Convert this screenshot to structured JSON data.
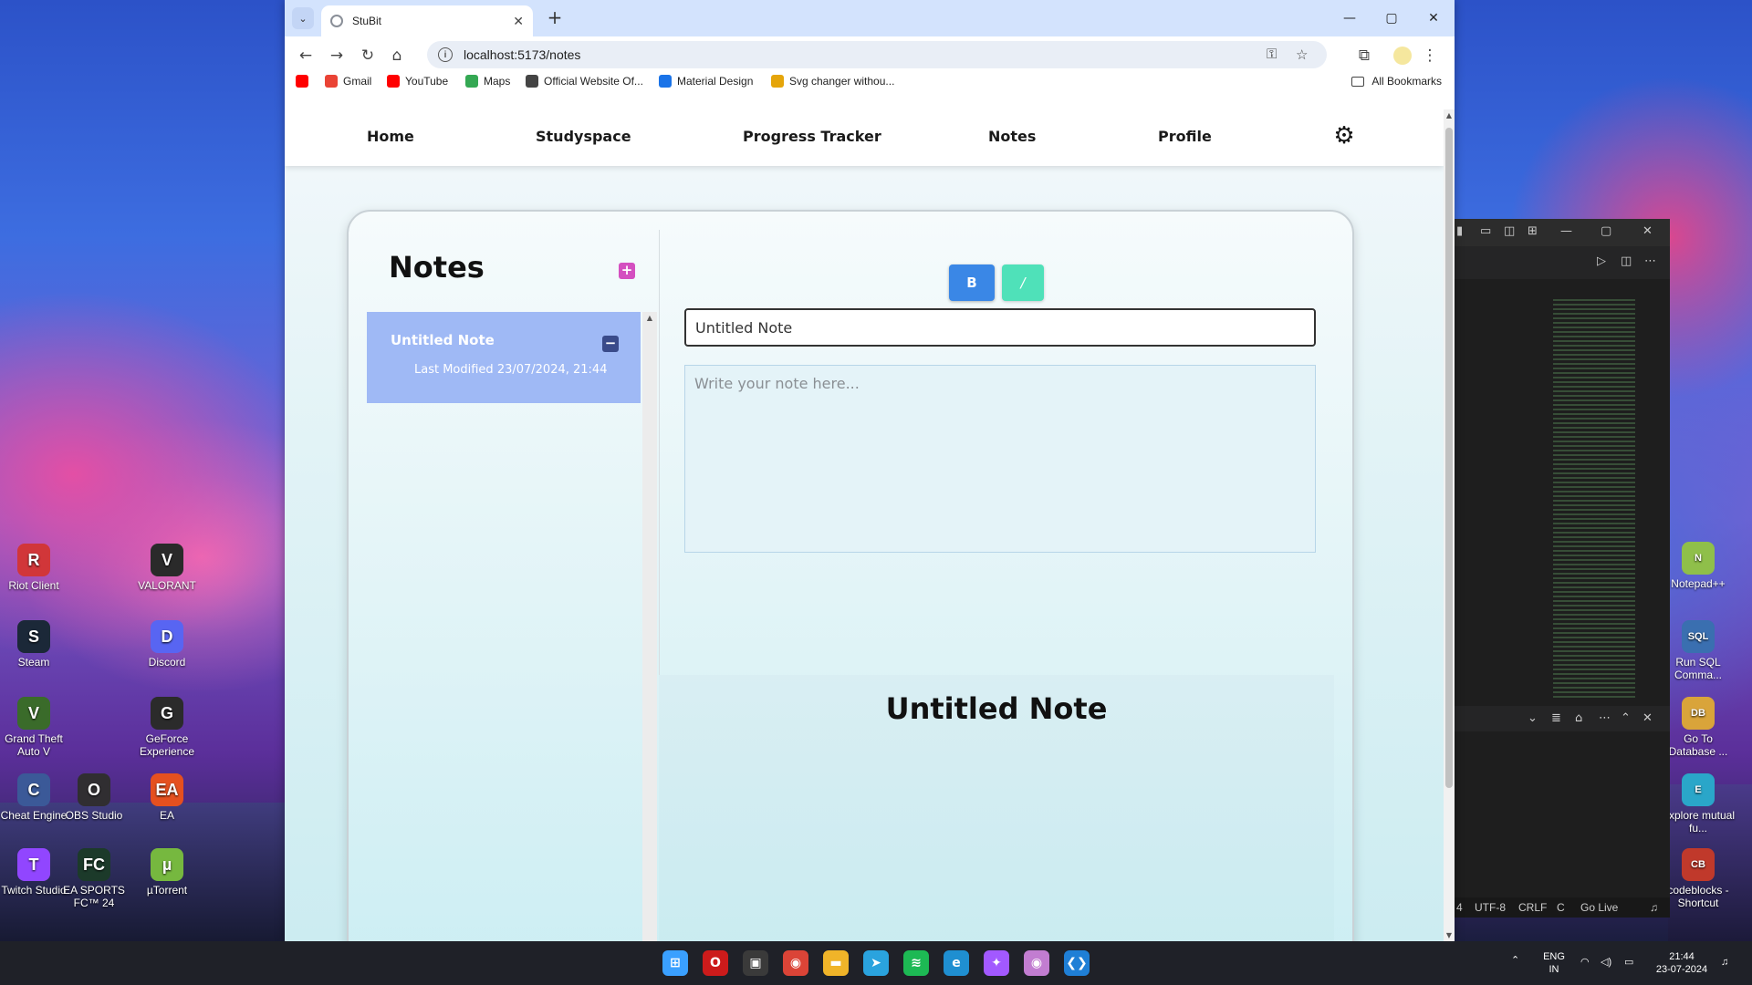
{
  "colors": {
    "tabbar": "#d3e3fd",
    "note_item_bg": "#9fb9f5",
    "bold_button": "#3a87e6",
    "italic_button": "#4fe1b9",
    "add_button": "#d44fc0",
    "remove_button": "#3a4b8a"
  },
  "desktop_left": [
    {
      "label": "Riot Client",
      "icon": "riot-icon",
      "color": "#d13639",
      "glyph": "R"
    },
    {
      "label": "VALORANT",
      "icon": "valorant-icon",
      "color": "#2a2a2a",
      "glyph": "V"
    },
    {
      "label": "Steam",
      "icon": "steam-icon",
      "color": "#1b2838",
      "glyph": "S"
    },
    {
      "label": "Discord",
      "icon": "discord-icon",
      "color": "#5865f2",
      "glyph": "D"
    },
    {
      "label": "Grand Theft Auto V",
      "icon": "gta-icon",
      "color": "#3a6b2a",
      "glyph": "V"
    },
    {
      "label": "GeForce Experience",
      "icon": "geforce-icon",
      "color": "#2b2b2b",
      "glyph": "G"
    },
    {
      "label": "Cheat Engine",
      "icon": "cheat-engine-icon",
      "color": "#3b5998",
      "glyph": "C"
    },
    {
      "label": "OBS Studio",
      "icon": "obs-icon",
      "color": "#302e31",
      "glyph": "O"
    },
    {
      "label": "EA",
      "icon": "ea-icon",
      "color": "#e5501f",
      "glyph": "EA"
    },
    {
      "label": "Twitch Studio",
      "icon": "twitch-icon",
      "color": "#9146ff",
      "glyph": "T"
    },
    {
      "label": "EA SPORTS FC™ 24",
      "icon": "fc24-icon",
      "color": "#1c3a2a",
      "glyph": "FC"
    },
    {
      "label": "µTorrent",
      "icon": "utorrent-icon",
      "color": "#76b83f",
      "glyph": "µ"
    }
  ],
  "desktop_right": [
    {
      "label": "Notepad++",
      "icon": "notepadpp-icon",
      "color": "#8fbf4a",
      "glyph": "N"
    },
    {
      "label": "Run SQL Comma...",
      "icon": "sql-icon",
      "color": "#3a6fb0",
      "glyph": "SQL"
    },
    {
      "label": "Go To Database ...",
      "icon": "database-icon",
      "color": "#d9a43a",
      "glyph": "DB"
    },
    {
      "label": "Explore mutual fu...",
      "icon": "explore-icon",
      "color": "#2aa6c9",
      "glyph": "E"
    },
    {
      "label": "codeblocks - Shortcut",
      "icon": "codeblocks-icon",
      "color": "#c0392b",
      "glyph": "CB"
    }
  ],
  "browser": {
    "tab_title": "StuBit",
    "url": "localhost:5173/notes",
    "bookmarks": [
      {
        "label": "",
        "icon": "youtube-icon",
        "color": "#ff0000"
      },
      {
        "label": "Gmail",
        "icon": "gmail-icon",
        "color": "#ea4335"
      },
      {
        "label": "YouTube",
        "icon": "youtube-icon",
        "color": "#ff0000"
      },
      {
        "label": "Maps",
        "icon": "maps-icon",
        "color": "#34a853"
      },
      {
        "label": "Official Website Of...",
        "icon": "globe-icon",
        "color": "#444444"
      },
      {
        "label": "Material Design",
        "icon": "material-icon",
        "color": "#1a73e8"
      },
      {
        "label": "Svg changer withou...",
        "icon": "svg-icon",
        "color": "#e5a50a"
      }
    ],
    "all_bookmarks": "All Bookmarks"
  },
  "app": {
    "nav": [
      "Home",
      "Studyspace",
      "Progress Tracker",
      "Notes",
      "Profile"
    ],
    "notes_heading": "Notes",
    "add_label": "+",
    "note": {
      "title": "Untitled Note",
      "modified": "Last Modified 23/07/2024, 21:44",
      "remove_label": "−"
    },
    "bold_label": "B",
    "italic_label": "/",
    "title_value": "Untitled Note",
    "body_placeholder": "Write your note here...",
    "preview_title": "Untitled Note"
  },
  "vscode": {
    "status": [
      "4",
      "UTF-8",
      "CRLF",
      "C",
      "Go Live"
    ]
  },
  "taskbar": {
    "apps": [
      {
        "name": "windows-start-icon",
        "color": "#3aa0ff",
        "glyph": "⊞"
      },
      {
        "name": "opera-icon",
        "color": "#cc1b1b",
        "glyph": "O"
      },
      {
        "name": "store-icon",
        "color": "#3a3a3a",
        "glyph": "▣"
      },
      {
        "name": "chrome-icon",
        "color": "#db4437",
        "glyph": "◉"
      },
      {
        "name": "file-explorer-icon",
        "color": "#f0b429",
        "glyph": "▬"
      },
      {
        "name": "telegram-icon",
        "color": "#2aa3de",
        "glyph": "➤"
      },
      {
        "name": "spotify-icon",
        "color": "#1db954",
        "glyph": "≋"
      },
      {
        "name": "edge-icon",
        "color": "#1f8fd1",
        "glyph": "e"
      },
      {
        "name": "figma-icon",
        "color": "#a259ff",
        "glyph": "✦"
      },
      {
        "name": "chrome-alt-icon",
        "color": "#c27dd1",
        "glyph": "◉"
      },
      {
        "name": "vscode-icon",
        "color": "#1f7fd6",
        "glyph": "❮❯"
      }
    ],
    "lang_top": "ENG",
    "lang_bottom": "IN",
    "time": "21:44",
    "date": "23-07-2024"
  }
}
